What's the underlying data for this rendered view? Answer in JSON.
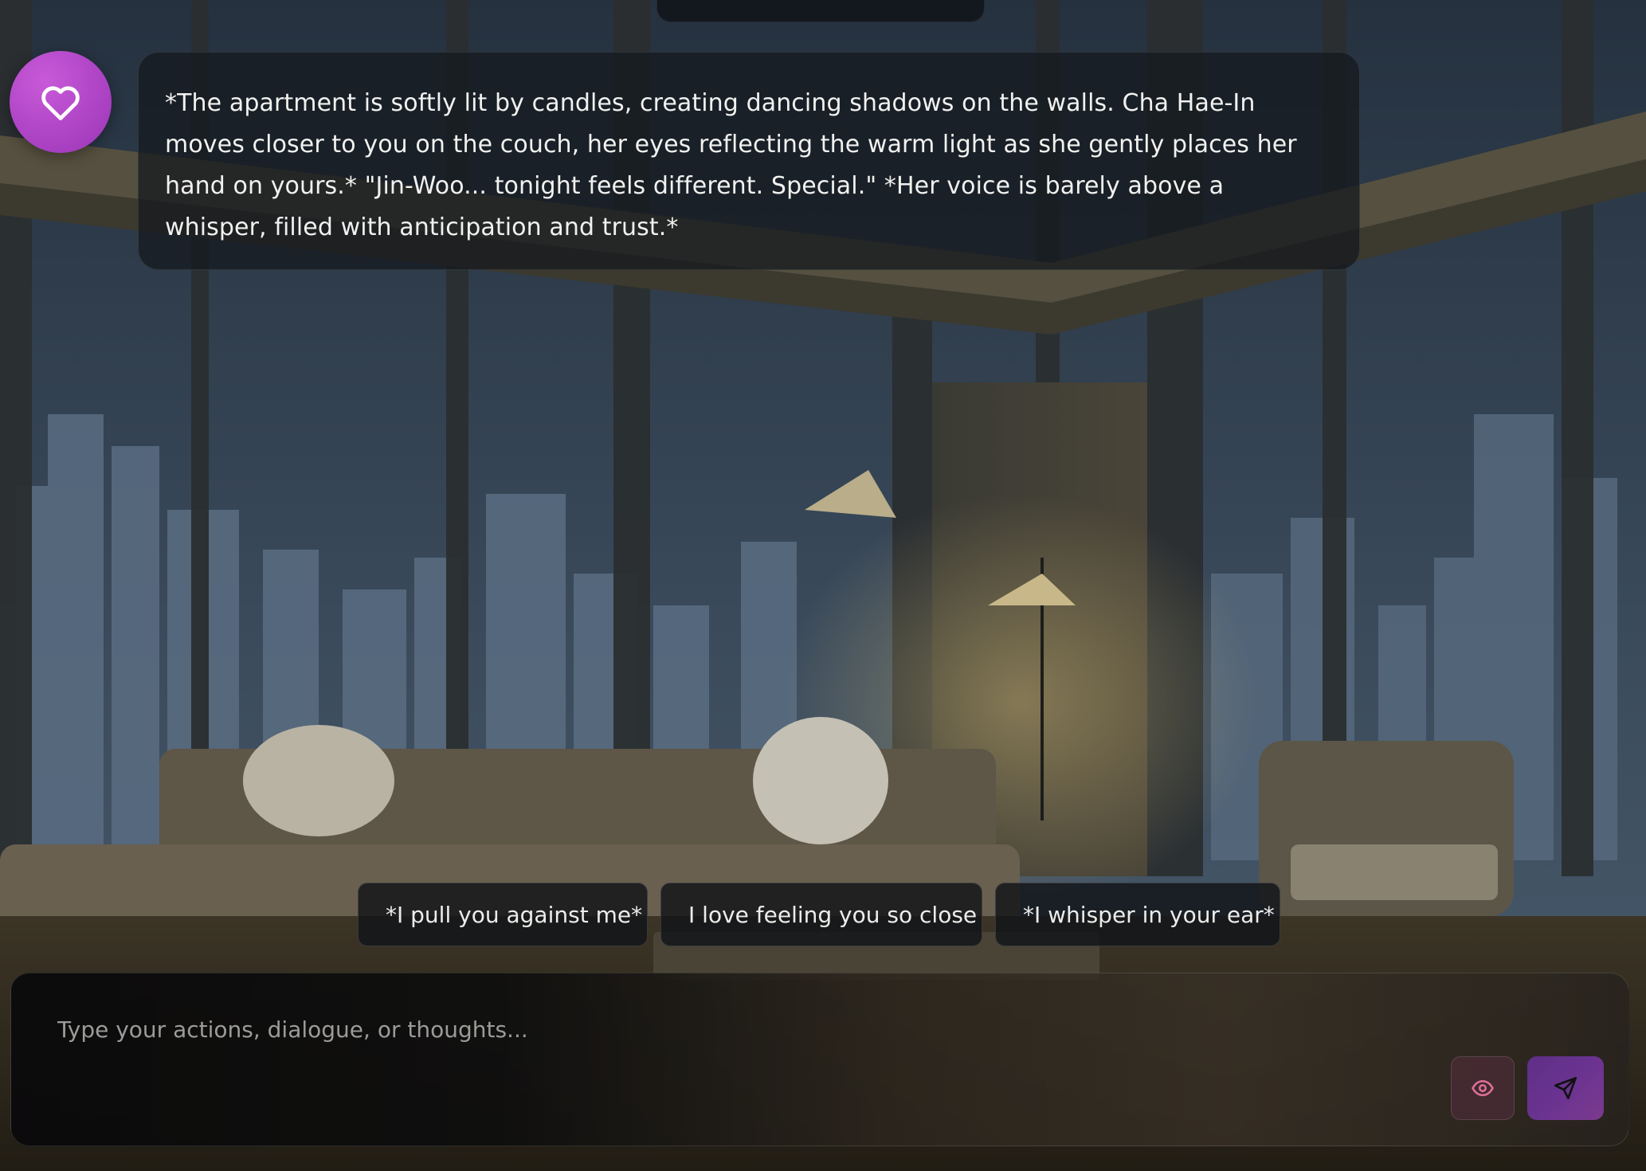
{
  "message": {
    "avatar_icon": "heart-icon",
    "text": "*The apartment is softly lit by candles, creating dancing shadows on the walls. Cha Hae-In moves closer to you on the couch, her eyes reflecting the warm light as she gently places her hand on yours.* \"Jin-Woo... tonight feels different. Special.\" *Her voice is barely above a whisper, filled with anticipation and trust.*"
  },
  "suggestions": [
    {
      "label": "*I pull you against me*"
    },
    {
      "label": "I love feeling you so close"
    },
    {
      "label": "*I whisper in your ear*"
    }
  ],
  "composer": {
    "placeholder": "Type your actions, dialogue, or thoughts...",
    "value": "",
    "toggle_icon": "eye-icon",
    "send_icon": "send-icon"
  },
  "colors": {
    "avatar": "#b349c9",
    "send_button": "#6a3390",
    "eye_icon": "#e0709a"
  }
}
